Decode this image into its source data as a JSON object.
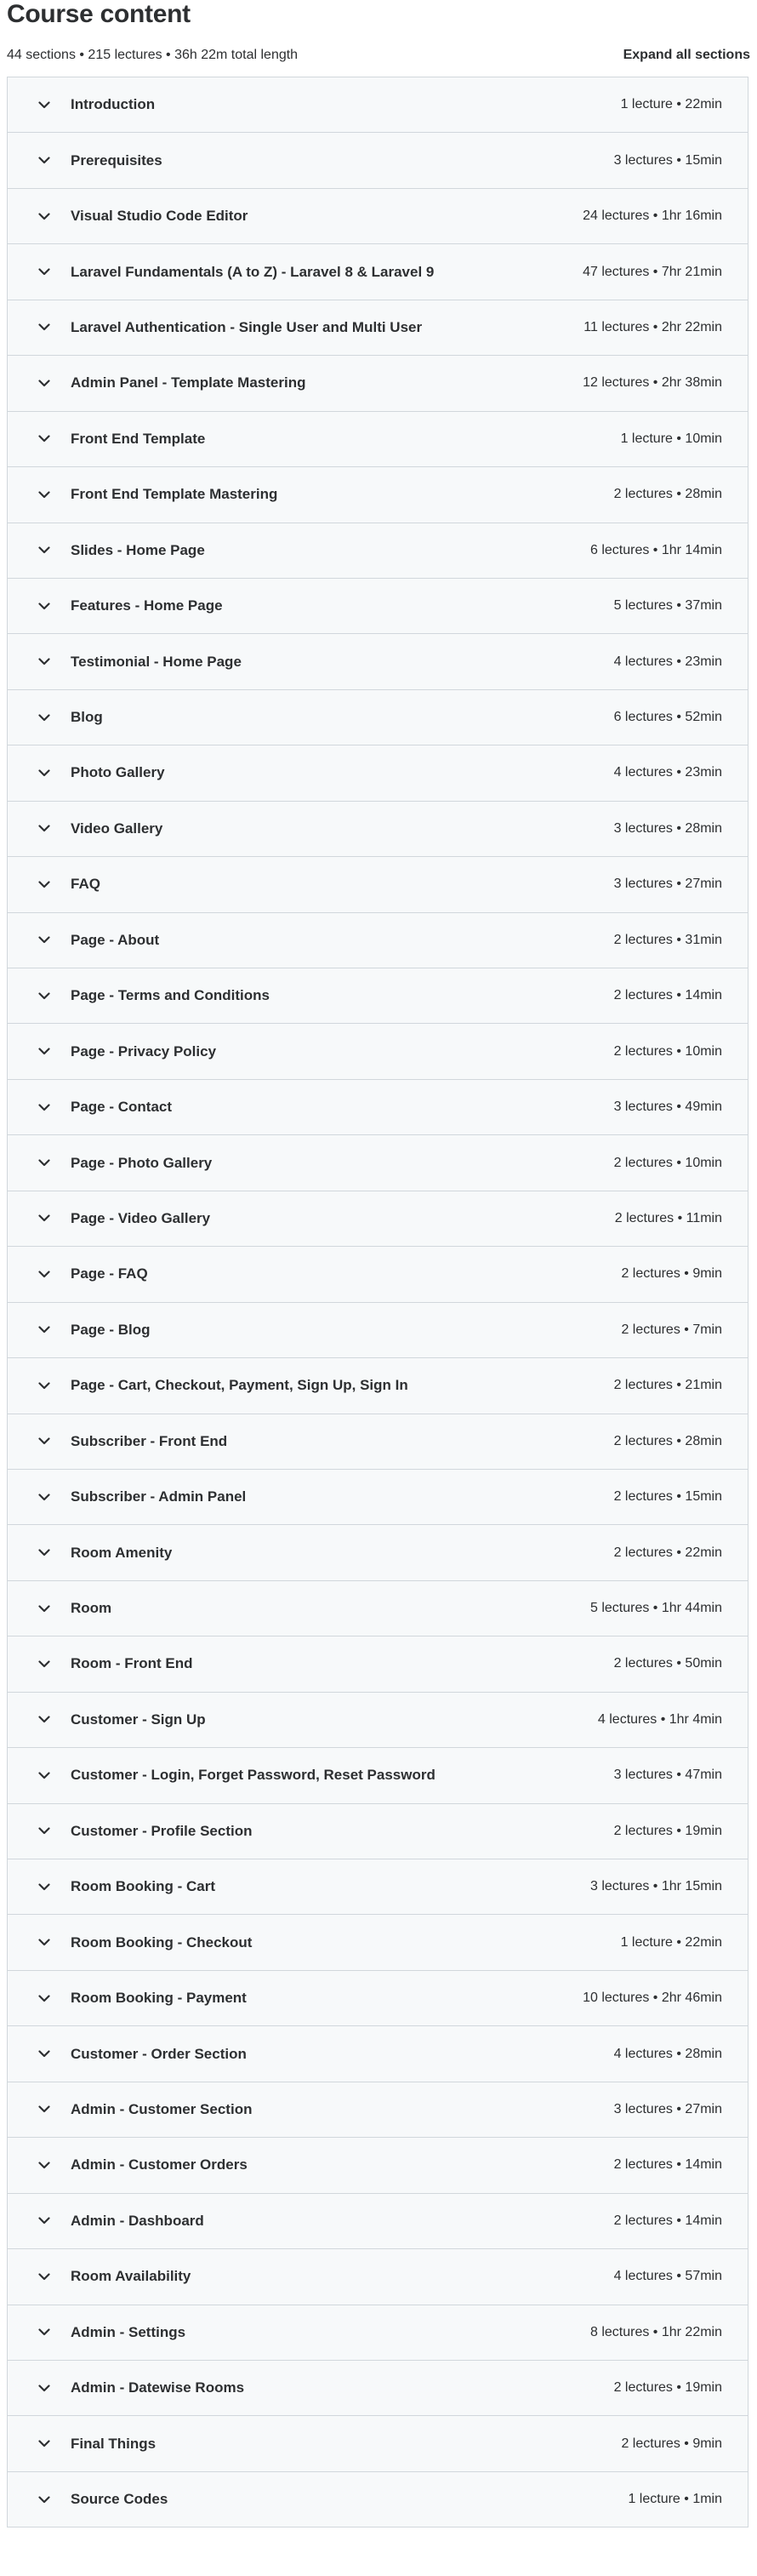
{
  "header": {
    "title": "Course content",
    "summary": "44 sections • 215 lectures • 36h 22m total length",
    "expand_all_label": "Expand all sections"
  },
  "sections": [
    {
      "title": "Introduction",
      "meta": "1 lecture • 22min"
    },
    {
      "title": "Prerequisites",
      "meta": "3 lectures • 15min"
    },
    {
      "title": "Visual Studio Code Editor",
      "meta": "24 lectures • 1hr 16min"
    },
    {
      "title": "Laravel Fundamentals (A to Z) - Laravel 8 & Laravel 9",
      "meta": "47 lectures • 7hr 21min"
    },
    {
      "title": "Laravel Authentication - Single User and Multi User",
      "meta": "11 lectures • 2hr 22min"
    },
    {
      "title": "Admin Panel - Template Mastering",
      "meta": "12 lectures • 2hr 38min"
    },
    {
      "title": "Front End Template",
      "meta": "1 lecture • 10min"
    },
    {
      "title": "Front End Template Mastering",
      "meta": "2 lectures • 28min"
    },
    {
      "title": "Slides - Home Page",
      "meta": "6 lectures • 1hr 14min"
    },
    {
      "title": "Features - Home Page",
      "meta": "5 lectures • 37min"
    },
    {
      "title": "Testimonial - Home Page",
      "meta": "4 lectures • 23min"
    },
    {
      "title": "Blog",
      "meta": "6 lectures • 52min"
    },
    {
      "title": "Photo Gallery",
      "meta": "4 lectures • 23min"
    },
    {
      "title": "Video Gallery",
      "meta": "3 lectures • 28min"
    },
    {
      "title": "FAQ",
      "meta": "3 lectures • 27min"
    },
    {
      "title": "Page - About",
      "meta": "2 lectures • 31min"
    },
    {
      "title": "Page - Terms and Conditions",
      "meta": "2 lectures • 14min"
    },
    {
      "title": "Page - Privacy Policy",
      "meta": "2 lectures • 10min"
    },
    {
      "title": "Page - Contact",
      "meta": "3 lectures • 49min"
    },
    {
      "title": "Page - Photo Gallery",
      "meta": "2 lectures • 10min"
    },
    {
      "title": "Page - Video Gallery",
      "meta": "2 lectures • 11min"
    },
    {
      "title": "Page - FAQ",
      "meta": "2 lectures • 9min"
    },
    {
      "title": "Page - Blog",
      "meta": "2 lectures • 7min"
    },
    {
      "title": "Page - Cart, Checkout, Payment, Sign Up, Sign In",
      "meta": "2 lectures • 21min"
    },
    {
      "title": "Subscriber - Front End",
      "meta": "2 lectures • 28min"
    },
    {
      "title": "Subscriber - Admin Panel",
      "meta": "2 lectures • 15min"
    },
    {
      "title": "Room Amenity",
      "meta": "2 lectures • 22min"
    },
    {
      "title": "Room",
      "meta": "5 lectures • 1hr 44min"
    },
    {
      "title": "Room - Front End",
      "meta": "2 lectures • 50min"
    },
    {
      "title": "Customer - Sign Up",
      "meta": "4 lectures • 1hr 4min"
    },
    {
      "title": "Customer - Login, Forget Password, Reset Password",
      "meta": "3 lectures • 47min"
    },
    {
      "title": "Customer - Profile Section",
      "meta": "2 lectures • 19min"
    },
    {
      "title": "Room Booking - Cart",
      "meta": "3 lectures • 1hr 15min"
    },
    {
      "title": "Room Booking - Checkout",
      "meta": "1 lecture • 22min"
    },
    {
      "title": "Room Booking - Payment",
      "meta": "10 lectures • 2hr 46min"
    },
    {
      "title": "Customer - Order Section",
      "meta": "4 lectures • 28min"
    },
    {
      "title": "Admin - Customer Section",
      "meta": "3 lectures • 27min"
    },
    {
      "title": "Admin - Customer Orders",
      "meta": "2 lectures • 14min"
    },
    {
      "title": "Admin - Dashboard",
      "meta": "2 lectures • 14min"
    },
    {
      "title": "Room Availability",
      "meta": "4 lectures • 57min"
    },
    {
      "title": "Admin - Settings",
      "meta": "8 lectures • 1hr 22min"
    },
    {
      "title": "Admin - Datewise Rooms",
      "meta": "2 lectures • 19min"
    },
    {
      "title": "Final Things",
      "meta": "2 lectures • 9min"
    },
    {
      "title": "Source Codes",
      "meta": "1 lecture • 1min"
    }
  ]
}
